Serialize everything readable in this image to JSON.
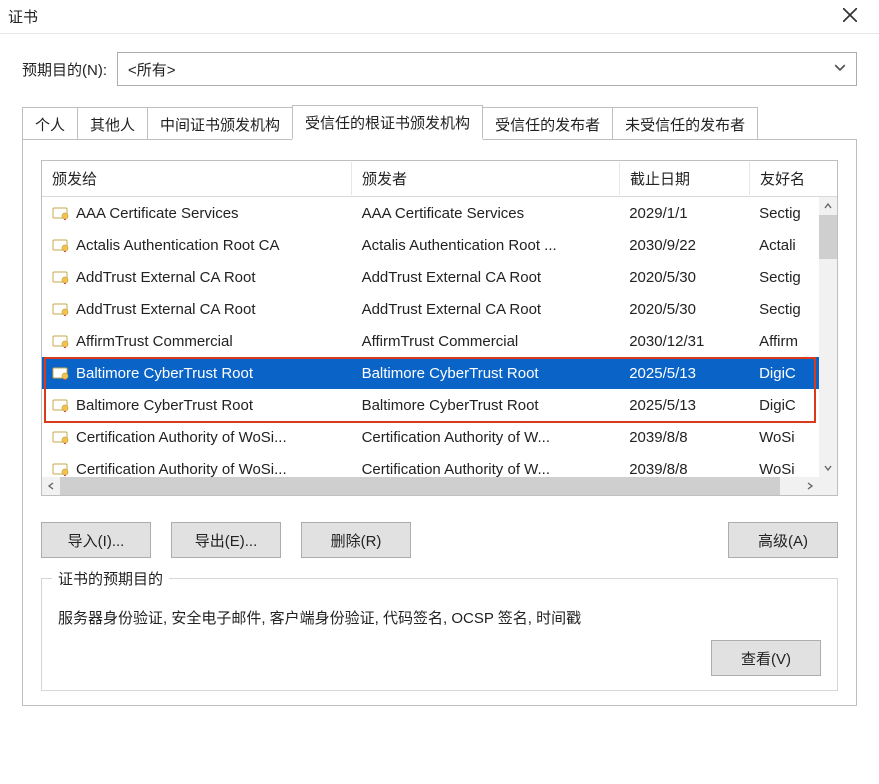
{
  "window": {
    "title": "证书"
  },
  "purpose": {
    "label": "预期目的(N):",
    "selected": "<所有>"
  },
  "tabs": [
    {
      "label": "个人"
    },
    {
      "label": "其他人"
    },
    {
      "label": "中间证书颁发机构"
    },
    {
      "label": "受信任的根证书颁发机构",
      "active": true
    },
    {
      "label": "受信任的发布者"
    },
    {
      "label": "未受信任的发布者"
    }
  ],
  "columns": {
    "issued_to": "颁发给",
    "issuer": "颁发者",
    "expiry": "截止日期",
    "friendly": "友好名"
  },
  "rows": [
    {
      "issued_to": "AAA Certificate Services",
      "issuer": "AAA Certificate Services",
      "expiry": "2029/1/1",
      "friendly": "Sectig"
    },
    {
      "issued_to": "Actalis Authentication Root CA",
      "issuer": "Actalis Authentication Root ...",
      "expiry": "2030/9/22",
      "friendly": "Actali"
    },
    {
      "issued_to": "AddTrust External CA Root",
      "issuer": "AddTrust External CA Root",
      "expiry": "2020/5/30",
      "friendly": "Sectig"
    },
    {
      "issued_to": "AddTrust External CA Root",
      "issuer": "AddTrust External CA Root",
      "expiry": "2020/5/30",
      "friendly": "Sectig"
    },
    {
      "issued_to": "AffirmTrust Commercial",
      "issuer": "AffirmTrust Commercial",
      "expiry": "2030/12/31",
      "friendly": "Affirm"
    },
    {
      "issued_to": "Baltimore CyberTrust Root",
      "issuer": "Baltimore CyberTrust Root",
      "expiry": "2025/5/13",
      "friendly": "DigiC",
      "selected": true
    },
    {
      "issued_to": "Baltimore CyberTrust Root",
      "issuer": "Baltimore CyberTrust Root",
      "expiry": "2025/5/13",
      "friendly": "DigiC"
    },
    {
      "issued_to": "Certification Authority of WoSi...",
      "issuer": "Certification Authority of W...",
      "expiry": "2039/8/8",
      "friendly": "WoSi"
    },
    {
      "issued_to": "Certification Authority of WoSi...",
      "issuer": "Certification Authority of W...",
      "expiry": "2039/8/8",
      "friendly": "WoSi"
    }
  ],
  "buttons": {
    "import": "导入(I)...",
    "export": "导出(E)...",
    "delete": "删除(R)",
    "advanced": "高级(A)",
    "view": "查看(V)"
  },
  "group": {
    "legend": "证书的预期目的",
    "purposes": "服务器身份验证, 安全电子邮件, 客户端身份验证, 代码签名, OCSP 签名, 时间戳"
  }
}
